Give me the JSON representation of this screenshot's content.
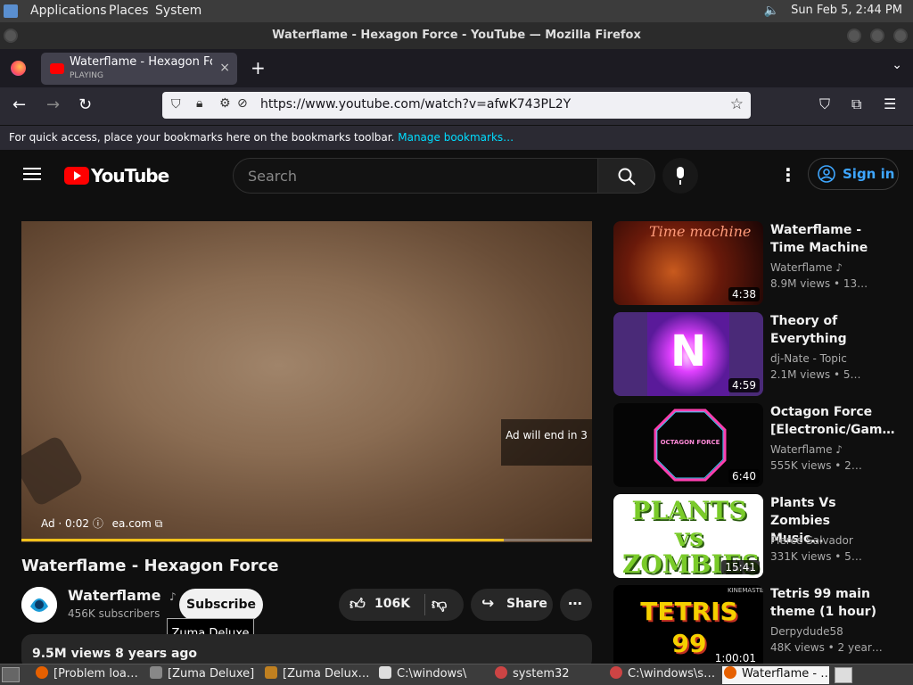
{
  "panel": {
    "menus": [
      "Applications",
      "Places",
      "System"
    ],
    "clock": "Sun Feb  5, 2:44 PM"
  },
  "window": {
    "title": "Waterflame - Hexagon Force - YouTube — Mozilla Firefox"
  },
  "tab": {
    "title": "Waterflame - Hexagon Force",
    "status": "PLAYING",
    "close": "×",
    "new_tab": "+"
  },
  "nav": {
    "url": "https://www.youtube.com/watch?v=afwK743PL2Y"
  },
  "bookmarks": {
    "message": "For quick access, place your bookmarks here on the bookmarks toolbar.",
    "manage_link": "Manage bookmarks…"
  },
  "youtube": {
    "logo": "YouTube",
    "search_placeholder": "Search",
    "sign_in": "Sign in",
    "player": {
      "ad_end": "Ad will end in 3",
      "ad_label": "Ad · 0:02",
      "ad_domain": "ea.com",
      "progress": 0.845
    },
    "video_title": "Waterflame - Hexagon Force",
    "channel": "Waterflame",
    "subscribers": "456K subscribers",
    "subscribe": "Subscribe",
    "tooltip": "Zuma Deluxe",
    "likes": "106K",
    "share": "Share",
    "description_meta": "9.5M views  8 years ago",
    "recommendations": [
      {
        "title": "Waterflame - Time Machine",
        "channel": "Waterflame",
        "meta": "8.9M views  • 13…",
        "duration": "4:38",
        "thumb_text": "Time machine",
        "color": "#3a0a0a"
      },
      {
        "title": "Theory of Everything",
        "channel": "dj-Nate - Topic",
        "meta": "2.1M views  • 5…",
        "duration": "4:59",
        "thumb_text": "N",
        "color": "#5a2a8a"
      },
      {
        "title": "Octagon Force [Electronic/Gam…",
        "channel": "Waterflame",
        "meta": "555K views  • 2…",
        "duration": "6:40",
        "thumb_text": "OCTAGON FORCE",
        "color": "#050505"
      },
      {
        "title": "Plants Vs Zombies Music…",
        "channel": "Pierce Salvador",
        "meta": "331K views  • 5…",
        "duration": "15:41",
        "thumb_text": "PLANTS vs ZOMBIES",
        "color": "#ffffff"
      },
      {
        "title": "Tetris 99 main theme (1 hour)",
        "channel": "Derpydude58",
        "meta": "48K views  • 2 year…",
        "duration": "1:00:01",
        "thumb_text": "TETRIS 99",
        "color": "#000000",
        "watermark": "KINEMASTER"
      }
    ]
  },
  "taskbar": {
    "items": [
      {
        "label": "[Problem loa…",
        "color": "#e66000"
      },
      {
        "label": "[Zuma Deluxe]",
        "color": "#888888"
      },
      {
        "label": "[Zuma Delux…",
        "color": "#c08020"
      },
      {
        "label": "C:\\windows\\",
        "color": "#dddddd"
      },
      {
        "label": "system32",
        "color": "#cc4444"
      },
      {
        "label": "C:\\windows\\s…",
        "color": "#cc4444"
      },
      {
        "label": "Waterflame - …",
        "color": "#e66000"
      }
    ]
  }
}
